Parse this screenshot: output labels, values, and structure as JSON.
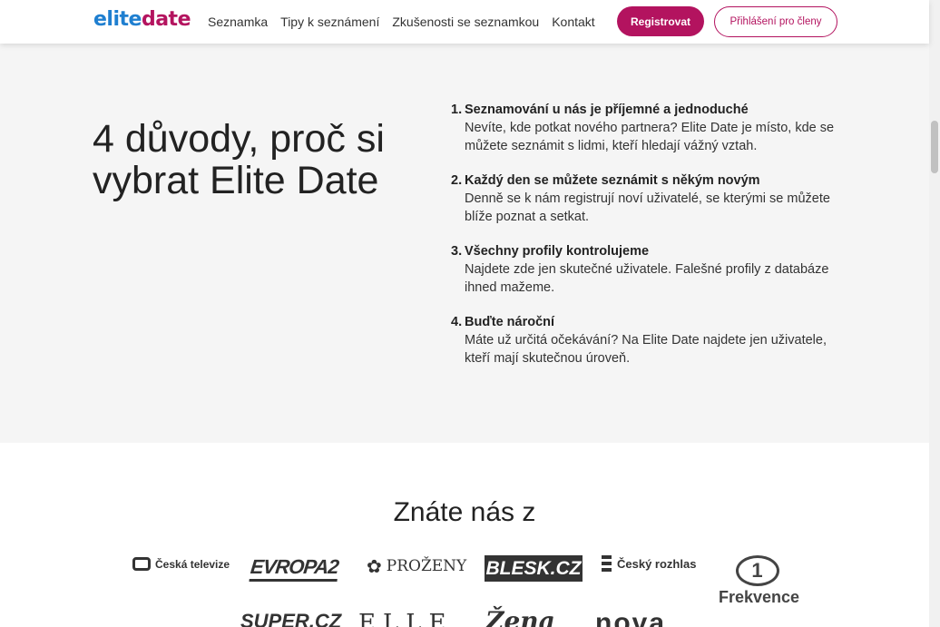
{
  "header": {
    "logo_part1": "elite",
    "logo_part2": "date",
    "nav": [
      "Seznamka",
      "Tipy k seznámení",
      "Zkušenosti se seznamkou",
      "Kontakt"
    ],
    "register_label": "Registrovat",
    "login_label": "Přihlášení pro členy"
  },
  "reasons": {
    "title": "4 důvody, proč si vybrat Elite Date",
    "items": [
      {
        "num": "1.",
        "title": "Seznamování u nás je příjemné a jednoduché",
        "text": "Nevíte, kde potkat nového partnera? Elite Date je místo, kde se můžete seznámit s lidmi, kteří hledají vážný vztah."
      },
      {
        "num": "2.",
        "title": "Každý den se můžete seznámit s někým novým",
        "text": "Denně se k nám registrují noví uživatelé, se kterými se můžete blíže poznat a setkat."
      },
      {
        "num": "3.",
        "title": "Všechny profily kontrolujeme",
        "text": "Najdete zde jen skutečné uživatele. Falešné profily z databáze ihned mažeme."
      },
      {
        "num": "4.",
        "title": "Buďte nároční",
        "text": "Máte už určitá očekávání? Na Elite Date najdete jen uživatele, kteří mají skutečnou úroveň."
      }
    ]
  },
  "media": {
    "title": "Znáte nás z",
    "logos": {
      "ct": "Česká televize",
      "evropa2": "EVROPA2",
      "prozeny": "PROŽENY",
      "blesk": "BLESK.CZ",
      "rozhlas": "Český rozhlas",
      "frekvence_num": "1",
      "frekvence": "Frekvence",
      "superczl": "SUPER.CZ",
      "elle": "ELLE",
      "zena": "Žena",
      "nova": "nova"
    }
  },
  "colors": {
    "brand": "#b3135f",
    "logo_blue": "#1f7fd0",
    "section_bg": "#f5f5f5"
  }
}
